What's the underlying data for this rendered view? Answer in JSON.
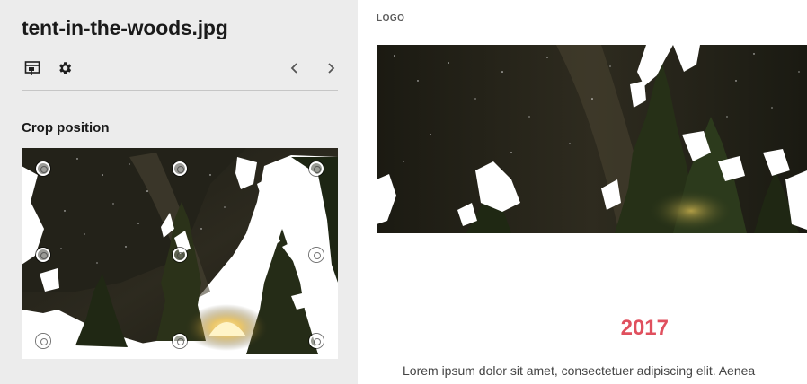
{
  "sidebar": {
    "filename": "tent-in-the-woods.jpg",
    "tools": {
      "crop_icon": "crop-layout-icon",
      "settings_icon": "gear-icon",
      "prev_icon": "chevron-left-icon",
      "next_icon": "chevron-right-icon"
    },
    "section_title": "Crop position"
  },
  "preview": {
    "logo": "LOGO",
    "year": "2017",
    "body_text": "Lorem ipsum dolor sit amet, consectetuer adipiscing elit. Aenea"
  },
  "colors": {
    "panel_bg": "#ececec",
    "accent": "#e0505e",
    "night_sky": "#1d1c12"
  }
}
